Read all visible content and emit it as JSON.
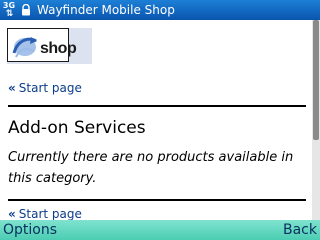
{
  "status_bar": {
    "network": "3G",
    "app_title": "Wayfinder Mobile Shop"
  },
  "logo": {
    "text": "shop"
  },
  "top_link": {
    "arrows": "«",
    "label": "Start page"
  },
  "category": {
    "title": "Add-on Services",
    "message": "Currently there are no products available in this category."
  },
  "bottom_link": {
    "arrows": "«",
    "label": "Start page"
  },
  "softkeys": {
    "left": "Options",
    "right": "Back"
  },
  "colors": {
    "title_bar": "#0a55ae",
    "softkey_bar": "#4bcdb3",
    "link": "#0b3e8a"
  }
}
